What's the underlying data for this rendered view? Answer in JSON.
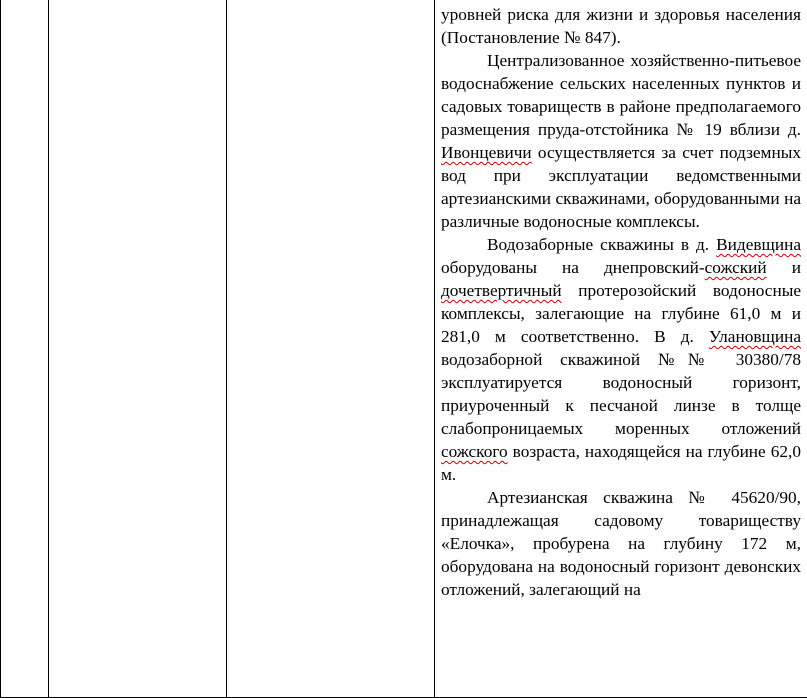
{
  "document": {
    "paragraphs": [
      {
        "indent": false,
        "segments": [
          {
            "text": "уровней риска для жизни и здоровья населения (Постановление № 847)."
          }
        ]
      },
      {
        "indent": true,
        "segments": [
          {
            "text": "Централизованное хозяйственно-питьевое водоснабжение сельских населенных пунктов и садовых товариществ в районе предполагаемого размещения пруда-отстойника № 19 вблизи д. "
          },
          {
            "text": "Ивонцевичи",
            "squiggle": true
          },
          {
            "text": " осуществляется за счет подземных вод при эксплуатации ведомственными артезианскими скважинами, оборудованными на различные водоносные комплексы."
          }
        ]
      },
      {
        "indent": true,
        "segments": [
          {
            "text": "Водозаборные скважины в д. "
          },
          {
            "text": "Видевщина",
            "squiggle": true
          },
          {
            "text": " оборудованы на днепровский-"
          },
          {
            "text": "сожский",
            "squiggle": true
          },
          {
            "text": " и "
          },
          {
            "text": "дочетвертичный",
            "squiggle": true
          },
          {
            "text": " протерозойский водоносные комплексы, залегающие на глубине 61,0 м и 281,0 м соответственно. В д. "
          },
          {
            "text": "Улановщина",
            "squiggle": true
          },
          {
            "text": " водозаборной скважиной №№ 30380/78 эксплуатируется водоносный горизонт, приуроченный к песчаной линзе в толще слабопроницаемых моренных отложений "
          },
          {
            "text": "сожского",
            "squiggle": true
          },
          {
            "text": " возраста, находящейся на глубине 62,0 м."
          }
        ]
      },
      {
        "indent": true,
        "segments": [
          {
            "text": "Артезианская скважина № 45620/90, принадлежащая садовому товариществу «Елочка», пробурена на глубину 172 м, оборудована на водоносный горизонт девонских отложений, залегающий на"
          }
        ]
      }
    ]
  }
}
